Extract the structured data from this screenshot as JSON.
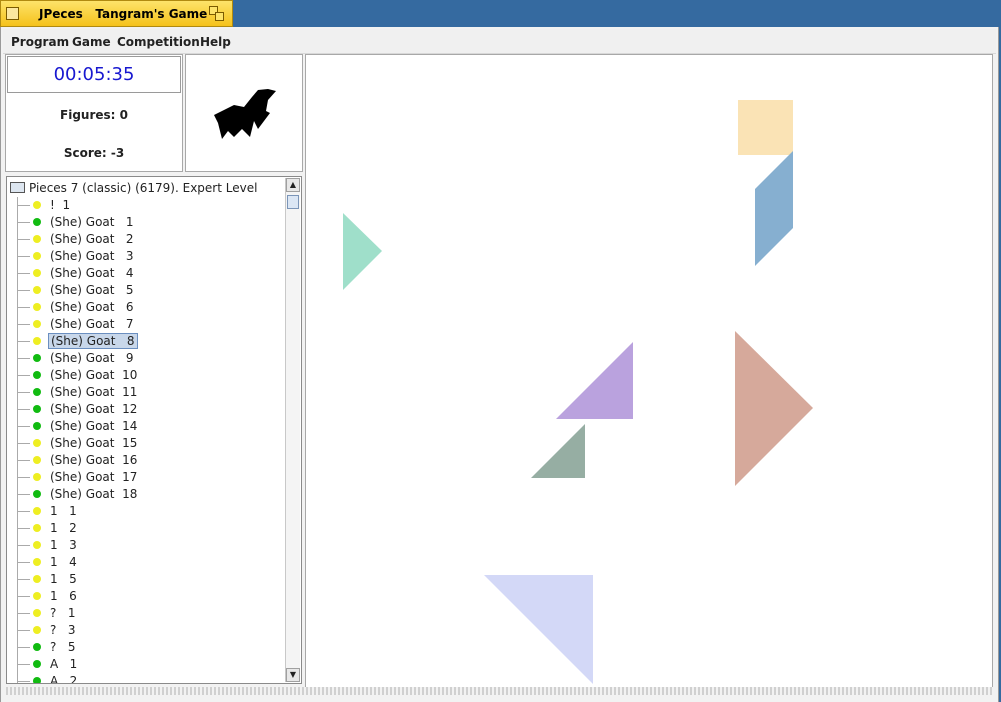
{
  "window": {
    "title": "JPeces   Tangram's Game"
  },
  "menu": [
    "Program",
    "Game",
    "Competition",
    "Help"
  ],
  "status": {
    "timer": "00:05:35",
    "figures": "Figures: 0",
    "score": "Score: -3"
  },
  "tree": {
    "root": "Pieces 7 (classic) (6179). Expert Level",
    "items": [
      {
        "label": "!  1",
        "status": "yellow"
      },
      {
        "label": "(She) Goat   1",
        "status": "green"
      },
      {
        "label": "(She) Goat   2",
        "status": "yellow"
      },
      {
        "label": "(She) Goat   3",
        "status": "yellow"
      },
      {
        "label": "(She) Goat   4",
        "status": "yellow"
      },
      {
        "label": "(She) Goat   5",
        "status": "yellow"
      },
      {
        "label": "(She) Goat   6",
        "status": "yellow"
      },
      {
        "label": "(She) Goat   7",
        "status": "yellow"
      },
      {
        "label": "(She) Goat   8",
        "status": "yellow",
        "selected": true
      },
      {
        "label": "(She) Goat   9",
        "status": "green"
      },
      {
        "label": "(She) Goat  10",
        "status": "green"
      },
      {
        "label": "(She) Goat  11",
        "status": "green"
      },
      {
        "label": "(She) Goat  12",
        "status": "green"
      },
      {
        "label": "(She) Goat  14",
        "status": "green"
      },
      {
        "label": "(She) Goat  15",
        "status": "yellow"
      },
      {
        "label": "(She) Goat  16",
        "status": "yellow"
      },
      {
        "label": "(She) Goat  17",
        "status": "yellow"
      },
      {
        "label": "(She) Goat  18",
        "status": "green"
      },
      {
        "label": "1   1",
        "status": "yellow"
      },
      {
        "label": "1   2",
        "status": "yellow"
      },
      {
        "label": "1   3",
        "status": "yellow"
      },
      {
        "label": "1   4",
        "status": "yellow"
      },
      {
        "label": "1   5",
        "status": "yellow"
      },
      {
        "label": "1   6",
        "status": "yellow"
      },
      {
        "label": "?   1",
        "status": "yellow"
      },
      {
        "label": "?   3",
        "status": "yellow"
      },
      {
        "label": "?   5",
        "status": "green"
      },
      {
        "label": "A   1",
        "status": "green"
      },
      {
        "label": "A   2",
        "status": "green"
      }
    ]
  },
  "colors": {
    "dot_yellow": "#eeee22",
    "dot_green": "#11bb11",
    "timer_text": "#1818d0",
    "piece_square": "#fae3b5",
    "piece_parallelogram": "#86afd0",
    "piece_small_teal": "#9fdfca",
    "piece_medium_purple": "#baa2de",
    "piece_small_grey": "#96aea3",
    "piece_large_red": "#d6a99b",
    "piece_large_blue": "#d3d8f7"
  }
}
